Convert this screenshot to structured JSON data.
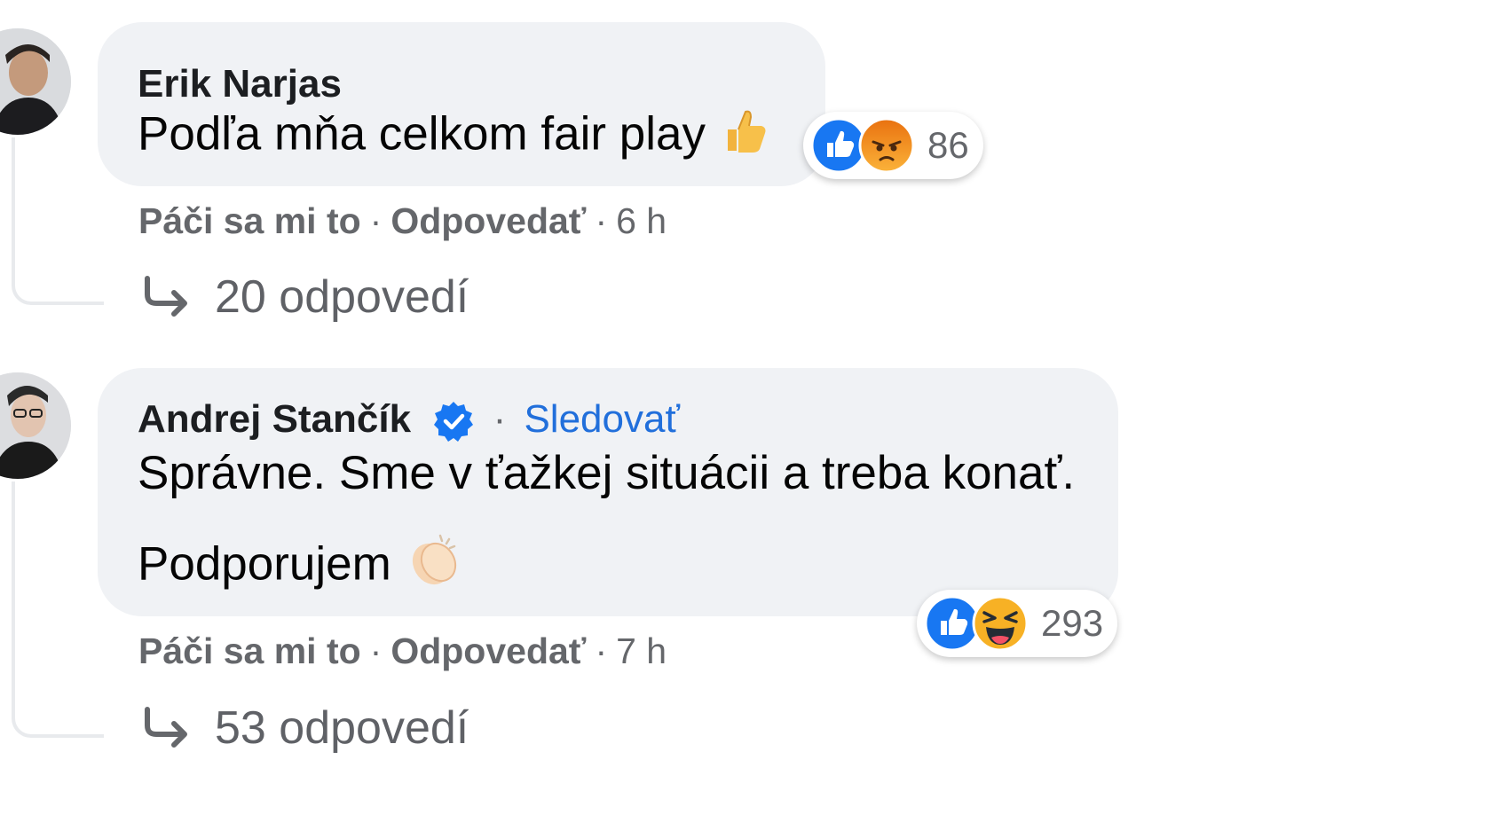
{
  "comments": [
    {
      "author": "Erik Narjas",
      "text": "Podľa mňa celkom fair play",
      "emoji": "thumbs-up",
      "reactions": {
        "icons": [
          "like",
          "angry"
        ],
        "count": "86"
      },
      "actions": {
        "like": "Páči sa mi to",
        "reply": "Odpovedať",
        "time": "6 h"
      },
      "replies": "20 odpovedí"
    },
    {
      "author": "Andrej Stančík",
      "verified": true,
      "follow": "Sledovať",
      "text_line1": "Správne. Sme v ťažkej situácii a treba konať.",
      "text_line2": "Podporujem",
      "emoji": "clapping-hands",
      "reactions": {
        "icons": [
          "like",
          "haha"
        ],
        "count": "293"
      },
      "actions": {
        "like": "Páči sa mi to",
        "reply": "Odpovedať",
        "time": "7 h"
      },
      "replies": "53 odpovedí"
    }
  ],
  "separator": "·",
  "colors": {
    "bubble": "#f0f2f5",
    "link": "#216fdb",
    "secondary_text": "#65676b",
    "like": "#1877f2",
    "angry": "#e9710f",
    "haha": "#f7b125"
  }
}
